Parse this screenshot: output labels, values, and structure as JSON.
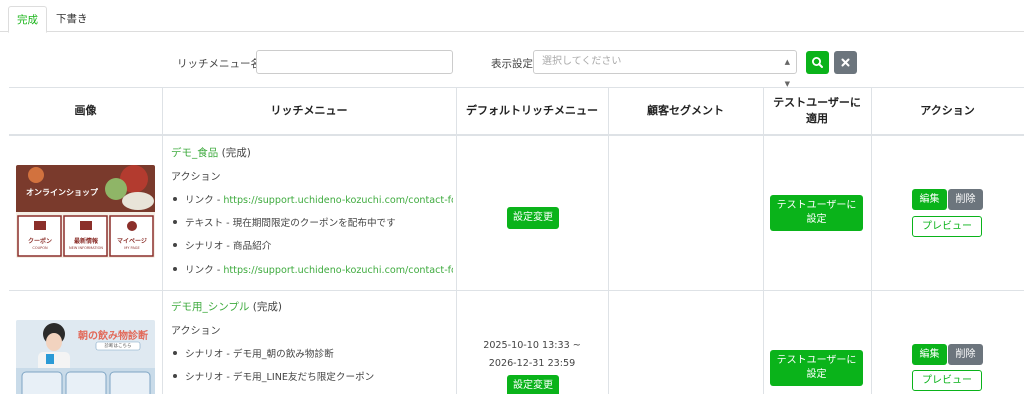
{
  "tabs": {
    "complete": "完成",
    "draft": "下書き"
  },
  "filter": {
    "name_label": "リッチメニュー名",
    "name_value": "",
    "display_label": "表示設定",
    "display_placeholder": "選択してください"
  },
  "table": {
    "headers": {
      "image": "画像",
      "richmenu": "リッチメニュー",
      "default": "デフォルトリッチメニュー",
      "segment": "顧客セグメント",
      "apply_test_line1": "テストユーザーに",
      "apply_test_line2": "適用",
      "action": "アクション"
    },
    "rows": [
      {
        "name": "デモ_食品",
        "status": "(完成)",
        "action_label": "アクション",
        "thumb": {
          "banner": "オンラインショップ",
          "btn1": "クーポン",
          "btn1_sub": "COUPON",
          "btn2": "最新情報",
          "btn2_sub": "NEW INFORMATION",
          "btn3": "マイページ",
          "btn3_sub": "MY PAGE"
        },
        "actions": [
          {
            "prefix": "リンク - ",
            "link": "https://support.uchideno-kozuchi.com/contact-form…"
          },
          {
            "prefix": "テキスト - 現在期間限定のクーポンを配布中です",
            "link": ""
          },
          {
            "prefix": "シナリオ - 商品紹介",
            "link": ""
          },
          {
            "prefix": "リンク - ",
            "link": "https://support.uchideno-kozuchi.com/contact-form…"
          }
        ],
        "period_start": "",
        "period_end": "",
        "default_button": "設定変更",
        "test_user_button_line1": "テストユーザーに",
        "test_user_button_line2": "設定",
        "edit": "編集",
        "delete": "削除",
        "preview": "プレビュー"
      },
      {
        "name": "デモ用_シンプル",
        "status": "(完成)",
        "action_label": "アクション",
        "thumb": {
          "banner": "朝の飲み物診断",
          "banner_sub": "診断はこちら"
        },
        "actions": [
          {
            "prefix": "シナリオ - デモ用_朝の飲み物診断",
            "link": ""
          },
          {
            "prefix": "シナリオ - デモ用_LINE友だち限定クーポン",
            "link": ""
          }
        ],
        "period_start": "2025-10-10 13:33 ~",
        "period_end": "2026-12-31 23:59",
        "default_button": "設定変更",
        "test_user_button_line1": "テストユーザーに",
        "test_user_button_line2": "設定",
        "edit": "編集",
        "delete": "削除",
        "preview": "プレビュー"
      }
    ]
  },
  "colors": {
    "accent": "#0ab31a",
    "link": "#3fab3f",
    "secondary": "#6c757d"
  }
}
